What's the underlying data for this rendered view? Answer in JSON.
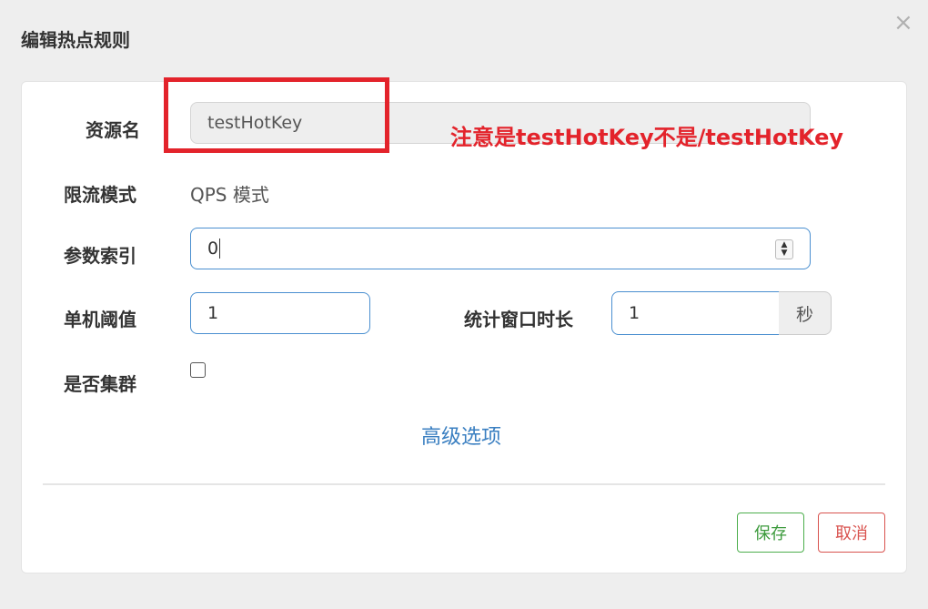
{
  "dialog": {
    "title": "编辑热点规则",
    "close_glyph": "×"
  },
  "form": {
    "resource_label": "资源名",
    "resource_value": "testHotKey",
    "mode_label": "限流模式",
    "mode_value": "QPS 模式",
    "param_index_label": "参数索引",
    "param_index_value": "0",
    "threshold_label": "单机阈值",
    "threshold_value": "1",
    "window_label": "统计窗口时长",
    "window_value": "1",
    "window_unit": "秒",
    "cluster_label": "是否集群",
    "cluster_checked": false,
    "advanced_link": "高级选项"
  },
  "annotation": {
    "text": "注意是testHotKey不是/testHotKey",
    "color": "#e3232b"
  },
  "footer": {
    "save_label": "保存",
    "cancel_label": "取消"
  },
  "icons": {
    "close": "close-icon",
    "spinner": "spinner-icon"
  }
}
